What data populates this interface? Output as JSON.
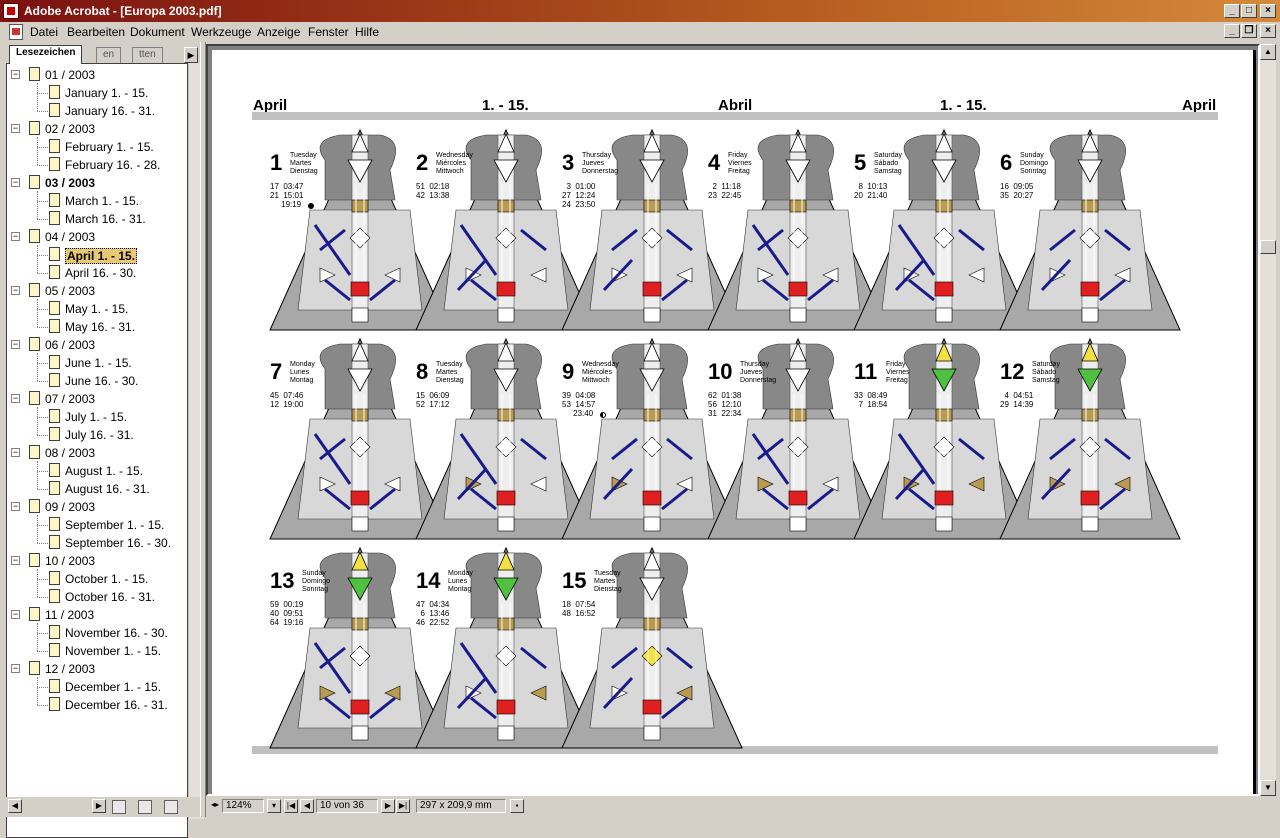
{
  "window": {
    "title": "Adobe Acrobat - [Europa 2003.pdf]"
  },
  "menu": [
    "Datei",
    "Bearbeiten",
    "Dokument",
    "Werkzeuge",
    "Anzeige",
    "Fenster",
    "Hilfe"
  ],
  "tabs": [
    "Lesezeichen",
    "Thumbnails",
    "Seiten"
  ],
  "tabs_visible": [
    "Lesezeichen",
    "en",
    "tten"
  ],
  "bookmarks": [
    {
      "label": "01 / 2003",
      "children": [
        "January 1. - 15.",
        "January 16. - 31."
      ]
    },
    {
      "label": "02 / 2003",
      "children": [
        "February 1. - 15.",
        "February 16. - 28."
      ]
    },
    {
      "label": "03 / 2003",
      "bold": true,
      "children": [
        "March 1. - 15.",
        "March 16. - 31."
      ]
    },
    {
      "label": "04 / 2003",
      "children": [
        "April 1. - 15.",
        "April 16. - 30."
      ],
      "selected": 0
    },
    {
      "label": "05 / 2003",
      "children": [
        "May 1. - 15.",
        "May 16. - 31."
      ]
    },
    {
      "label": "06 / 2003",
      "children": [
        "June 1. - 15.",
        "June 16. - 30."
      ]
    },
    {
      "label": "07 / 2003",
      "children": [
        "July 1. - 15.",
        "July 16. - 31."
      ]
    },
    {
      "label": "08 / 2003",
      "children": [
        "August 1. - 15.",
        "August 16. - 31."
      ]
    },
    {
      "label": "09 / 2003",
      "children": [
        "September 1. - 15.",
        "September 16. - 30."
      ]
    },
    {
      "label": "10 / 2003",
      "children": [
        "October 1. - 15.",
        "October 16. - 31."
      ]
    },
    {
      "label": "11 / 2003",
      "children": [
        "November 16. - 30.",
        "November 1. - 15."
      ]
    },
    {
      "label": "12 / 2003",
      "children": [
        "December 1. - 15.",
        "December 16. - 31."
      ]
    }
  ],
  "status": {
    "zoom": "124%",
    "page": "10 von 36",
    "size": "297 x 209,9 mm"
  },
  "doc": {
    "header": [
      "April",
      "1. - 15.",
      "Abril",
      "1. - 15.",
      "April"
    ],
    "days": [
      {
        "n": "1",
        "names": "Tuesday\nMartes\nDienstag",
        "lines": "17  03:47\n21  15:01\n     19:19",
        "moon": "full",
        "head": "none"
      },
      {
        "n": "2",
        "names": "Wednesday\nMiércoles\nMittwoch",
        "lines": "51  02:18\n42  13:38",
        "moon": "",
        "head": "none"
      },
      {
        "n": "3",
        "names": "Thursday\nJueves\nDonnerstag",
        "lines": "  3  01:00\n27  12:24\n24  23:50",
        "moon": "",
        "head": "none"
      },
      {
        "n": "4",
        "names": "Friday\nViernes\nFreitag",
        "lines": "  2  11:18\n23  22:45",
        "moon": "",
        "head": "none"
      },
      {
        "n": "5",
        "names": "Saturday\nSábado\nSamstag",
        "lines": "  8  10:13\n20  21:40",
        "moon": "",
        "head": "none"
      },
      {
        "n": "6",
        "names": "Sunday\nDomingo\nSonntag",
        "lines": "16  09:05\n35  20:27",
        "moon": "",
        "head": "none"
      },
      {
        "n": "7",
        "names": "Monday\nLunes\nMontag",
        "lines": "45  07:46\n12  19:00",
        "moon": "",
        "head": "none"
      },
      {
        "n": "8",
        "names": "Tuesday\nMartes\nDienstag",
        "lines": "15  06:09\n52  17:12",
        "moon": "",
        "head": "none"
      },
      {
        "n": "9",
        "names": "Wednesday\nMiércoles\nMittwoch",
        "lines": "39  04:08\n53  14:57\n     23:40",
        "moon": "half",
        "head": "none"
      },
      {
        "n": "10",
        "names": "Thursday\nJueves\nDonnerstag",
        "lines": "62  01:38\n56  12:10\n31  22:34",
        "moon": "",
        "head": "none"
      },
      {
        "n": "11",
        "names": "Friday\nViernes\nFreitag",
        "lines": "33  08:49\n  7  18:54",
        "moon": "",
        "head": "color"
      },
      {
        "n": "12",
        "names": "Saturday\nSábado\nSamstag",
        "lines": "  4  04:51\n29  14:39",
        "moon": "",
        "head": "color"
      },
      {
        "n": "13",
        "names": "Sunday\nDomingo\nSonntag",
        "lines": "59  00:19\n40  09:51\n64  19:16",
        "moon": "",
        "head": "color"
      },
      {
        "n": "14",
        "names": "Monday\nLunes\nMontag",
        "lines": "47  04:34\n  6  13:46\n46  22:52",
        "moon": "",
        "head": "color"
      },
      {
        "n": "15",
        "names": "Tuesday\nMartes\nDienstag",
        "lines": "18  07:54\n48  16:52",
        "moon": "",
        "head": "none"
      }
    ]
  },
  "colors": {
    "channel": "#1a1a8c",
    "root": "#e02020",
    "heart": "#b89a50",
    "yellow": "#f4e040",
    "green": "#50c040",
    "triangle": "#a8a8a8"
  }
}
